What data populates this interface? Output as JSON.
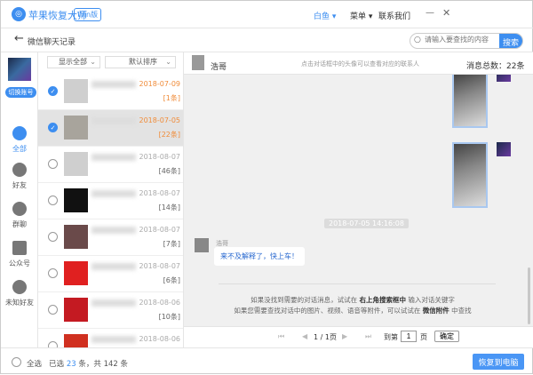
{
  "app": {
    "logo_glyph": "◎",
    "name": "苹果恢复大师",
    "badge": "Win版",
    "user": "白鱼 ▾",
    "menu": "菜单 ▾",
    "contact": "联系我们",
    "minimize": "—",
    "close": "✕"
  },
  "subheader": {
    "back": "←",
    "title": "微信聊天记录",
    "search_placeholder": "请输入要查找的内容",
    "search_button": "搜索"
  },
  "nav": {
    "switch_account": "切换账号",
    "items": [
      {
        "label": "全部",
        "icon": "grid-icon",
        "active": true
      },
      {
        "label": "好友",
        "icon": "person-icon"
      },
      {
        "label": "群聊",
        "icon": "group-icon"
      },
      {
        "label": "公众号",
        "icon": "tiles-icon"
      },
      {
        "label": "未知好友",
        "icon": "unknown-person-icon"
      }
    ]
  },
  "list": {
    "filter_show": "显示全部",
    "filter_sort": "默认排序",
    "chevron": "⌄",
    "items": [
      {
        "date": "2018-07-09",
        "count": "[1条]",
        "checked": true,
        "avatar": "#cfcfcf"
      },
      {
        "date": "2018-07-05",
        "count": "[22条]",
        "checked": true,
        "selected": true,
        "avatar": "#a8a49c"
      },
      {
        "date": "2018-08-07",
        "count": "[46条]",
        "avatar": "#cfcfcf"
      },
      {
        "date": "2018-08-07",
        "count": "[14条]",
        "avatar": "#111111"
      },
      {
        "date": "2018-08-07",
        "count": "[7条]",
        "avatar": "#6a4a4a"
      },
      {
        "date": "2018-08-07",
        "count": "[6条]",
        "avatar": "#e02020"
      },
      {
        "date": "2018-08-06",
        "count": "[10条]",
        "avatar": "#c41a22"
      },
      {
        "date": "2018-08-06",
        "count": "",
        "avatar": "#d03020"
      }
    ]
  },
  "chat": {
    "contact": "浩哥",
    "hint": "点击对话框中的头像可以查看对应的联系人",
    "total": "消息总数：22条",
    "timestamp": "2018-07-05 14:16:08",
    "sender": "浩哥",
    "message": "来不及解释了，快上车！",
    "tip1_a": "如果没找到需要的对话消息，试试在 ",
    "tip1_b": "右上角搜索框中",
    "tip1_c": " 输入对话关键字",
    "tip2_a": "如果您需要查找对话中的图片、视频、语音等附件，可以试试在 ",
    "tip2_b": "微信附件",
    "tip2_c": " 中查找"
  },
  "pager": {
    "first": "⏮",
    "prev": "◀",
    "page": "1 / 1页",
    "next": "▶",
    "last": "⏭",
    "goto_label": "到第",
    "goto_value": "1",
    "page_unit": "页",
    "confirm": "确定"
  },
  "footer": {
    "select_all": "全选",
    "selected_prefix": "已选 ",
    "selected_count": "23",
    "selected_mid": " 条，共 ",
    "total_count": "142",
    "selected_suffix": " 条",
    "restore": "恢复到电脑"
  },
  "colors": {
    "accent": "#3d8ef0",
    "highlight": "#f08c3a"
  }
}
